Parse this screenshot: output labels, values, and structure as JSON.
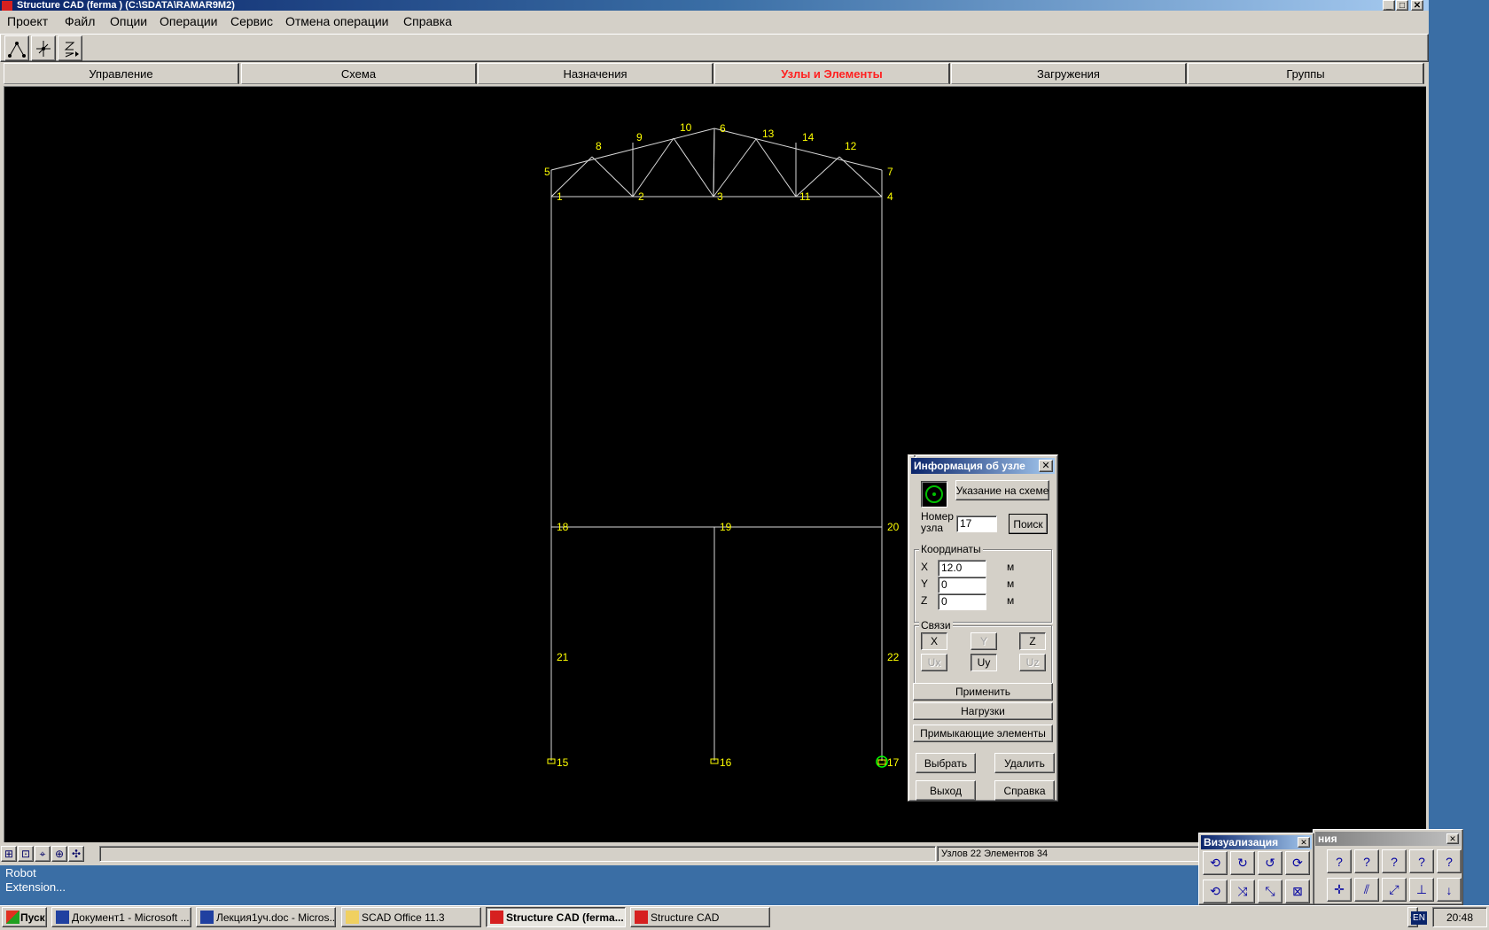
{
  "window": {
    "title": "Structure CAD (ferma ) (C:\\SDATA\\RAMAR9M2)",
    "minimize": "_",
    "maximize": "□",
    "close": "✕"
  },
  "menu": [
    "Проект",
    "Файл",
    "Опции",
    "Операции",
    "Сервис",
    "Отмена операции",
    "Справка"
  ],
  "toolbar_icons": [
    "node-create-icon",
    "node-move-icon",
    "node-number-icon"
  ],
  "tabs": [
    {
      "label": "Управление",
      "active": false
    },
    {
      "label": "Схема",
      "active": false
    },
    {
      "label": "Назначения",
      "active": false
    },
    {
      "label": "Узлы и Элементы",
      "active": true
    },
    {
      "label": "Загружения",
      "active": false
    },
    {
      "label": "Группы",
      "active": false
    }
  ],
  "model": {
    "line_color": "#d8d8d8",
    "label_color": "#ffff00",
    "node_labels": [
      "1",
      "2",
      "3",
      "4",
      "5",
      "6",
      "7",
      "8",
      "9",
      "10",
      "11",
      "12",
      "13",
      "14",
      "15",
      "16",
      "17",
      "18",
      "19",
      "20",
      "21",
      "22"
    ],
    "selected_node": "17",
    "selected_color": "#00ff00"
  },
  "node_dialog": {
    "title": "Информация об узле",
    "pick_button": "Указание на схеме",
    "node_number_label": "Номер\nузла",
    "node_number_value": "17",
    "search_button": "Поиск",
    "coords_group": "Координаты",
    "coords": [
      {
        "axis": "X",
        "value": "12.0",
        "unit": "м"
      },
      {
        "axis": "Y",
        "value": "0",
        "unit": "м"
      },
      {
        "axis": "Z",
        "value": "0",
        "unit": "м"
      }
    ],
    "constraints_group": "Связи",
    "constraints": [
      {
        "label": "X",
        "state": "pressed"
      },
      {
        "label": "Y",
        "state": "disabled"
      },
      {
        "label": "Z",
        "state": "pressed"
      },
      {
        "label": "Ux",
        "state": "disabled"
      },
      {
        "label": "Uy",
        "state": "pressed"
      },
      {
        "label": "Uz",
        "state": "disabled"
      }
    ],
    "apply_button": "Применить",
    "loads_button": "Нагрузки",
    "adjacent_button": "Примыкающие элементы",
    "select_button": "Выбрать",
    "delete_button": "Удалить",
    "exit_button": "Выход",
    "help_button": "Справка"
  },
  "status": {
    "counts": "Узлов 22 Элементов 34"
  },
  "desktop_label": "Robot\nExtension...",
  "viz_panel": {
    "title": "Визуализация",
    "title2": "ния",
    "close": "✕"
  },
  "taskbar": {
    "start": "Пуск",
    "tasks": [
      {
        "label": "Документ1 - Microsoft ...",
        "icon": "word-icon"
      },
      {
        "label": "Лекция1уч.doc - Micros...",
        "icon": "word-icon"
      },
      {
        "label": "SCAD Office 11.3",
        "icon": "folder-icon"
      },
      {
        "label": "Structure CAD (ferma...",
        "icon": "scad-icon",
        "active": true
      },
      {
        "label": "Structure CAD",
        "icon": "scad-icon"
      }
    ],
    "lang": "EN",
    "clock": "20:48",
    "tray_chevron": "«"
  }
}
